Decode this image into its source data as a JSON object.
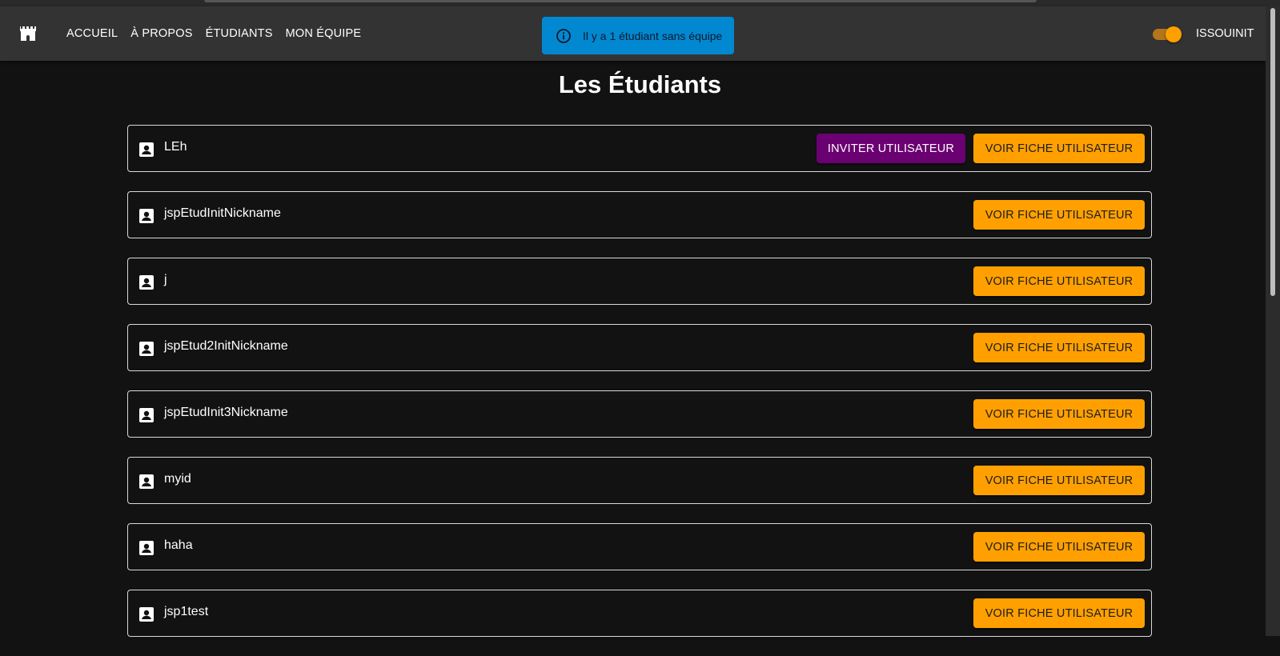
{
  "colors": {
    "appbar": "#333333",
    "background": "#121212",
    "accent_orange": "#ffa000",
    "invite_purple": "#6a0072",
    "alert_blue": "#0288d1"
  },
  "header": {
    "logo_icon": "castle-icon",
    "nav": [
      "Accueil",
      "À propos",
      "Étudiants",
      "Mon équipe"
    ],
    "user_label": "ISSOUINIT",
    "theme_toggle": {
      "on": true
    }
  },
  "alert": {
    "icon": "info-icon",
    "text": "Il y a 1 étudiant sans équipe"
  },
  "main": {
    "title": "Les Étudiants",
    "invite_label": "INVITER UTILISATEUR",
    "view_label": "VOIR FICHE UTILISATEUR",
    "students": [
      {
        "name": "LEh",
        "can_invite": true
      },
      {
        "name": "jspEtudInitNickname",
        "can_invite": false
      },
      {
        "name": "j",
        "can_invite": false
      },
      {
        "name": "jspEtud2InitNickname",
        "can_invite": false
      },
      {
        "name": "jspEtudInit3Nickname",
        "can_invite": false
      },
      {
        "name": "myid",
        "can_invite": false
      },
      {
        "name": "haha",
        "can_invite": false
      },
      {
        "name": "jsp1test",
        "can_invite": false
      }
    ]
  }
}
